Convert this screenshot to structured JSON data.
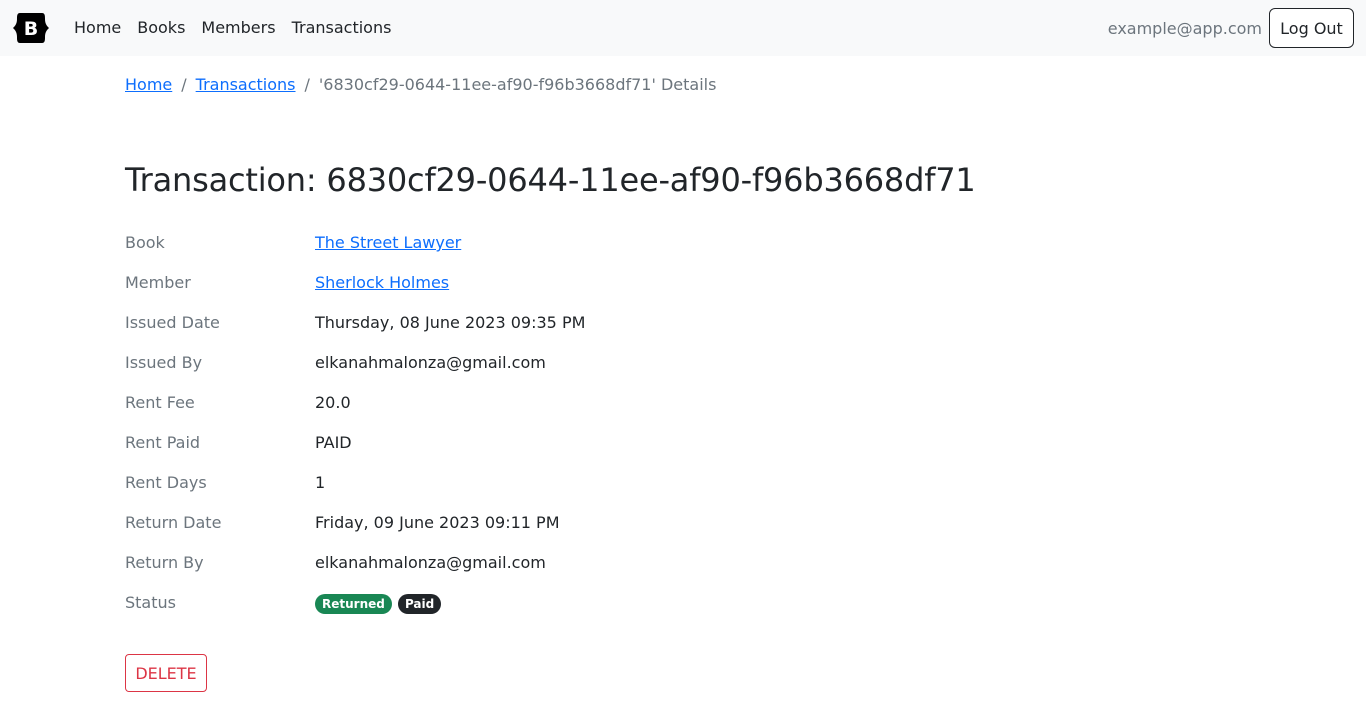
{
  "navbar": {
    "brand_letter": "B",
    "links": [
      "Home",
      "Books",
      "Members",
      "Transactions"
    ],
    "user_email": "example@app.com",
    "logout_label": "Log Out"
  },
  "breadcrumb": {
    "home": "Home",
    "transactions": "Transactions",
    "current": "'6830cf29-0644-11ee-af90-f96b3668df71' Details",
    "separator": "/"
  },
  "page": {
    "title": "Transaction: 6830cf29-0644-11ee-af90-f96b3668df71"
  },
  "details": {
    "book_label": "Book",
    "book_value": "The Street Lawyer",
    "member_label": "Member",
    "member_value": "Sherlock Holmes",
    "issued_date_label": "Issued Date",
    "issued_date_value": "Thursday, 08 June 2023 09:35 PM",
    "issued_by_label": "Issued By",
    "issued_by_value": "elkanahmalonza@gmail.com",
    "rent_fee_label": "Rent Fee",
    "rent_fee_value": "20.0",
    "rent_paid_label": "Rent Paid",
    "rent_paid_value": "PAID",
    "rent_days_label": "Rent Days",
    "rent_days_value": "1",
    "return_date_label": "Return Date",
    "return_date_value": "Friday, 09 June 2023 09:11 PM",
    "return_by_label": "Return By",
    "return_by_value": "elkanahmalonza@gmail.com",
    "status_label": "Status",
    "status_badges": [
      "Returned",
      "Paid"
    ]
  },
  "actions": {
    "delete_label": "DELETE"
  },
  "colors": {
    "primary_link": "#0d6efd",
    "success": "#198754",
    "dark": "#212529",
    "danger": "#dc3545",
    "muted": "#6c757d",
    "navbar_bg": "#f8f9fa"
  }
}
